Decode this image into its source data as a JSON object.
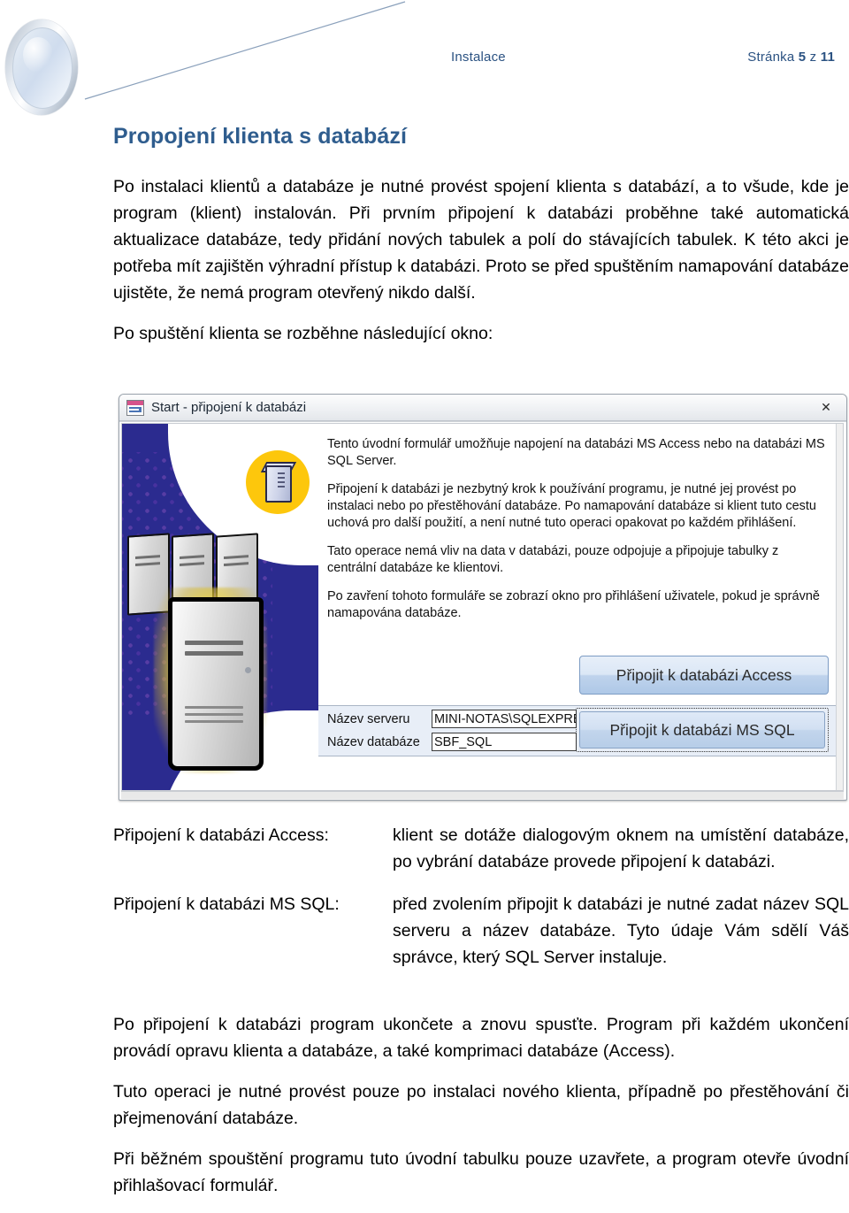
{
  "header": {
    "logo_name": "ellipse-disc-logo",
    "document_title": "Instalace",
    "page_label_prefix": "Stránka ",
    "page_current": "5",
    "page_mid": " z ",
    "page_total": "11",
    "accent_color": "#2b5282"
  },
  "heading": {
    "text": "Propojení klienta s databází",
    "color": "#2f5d8e"
  },
  "intro": {
    "paragraph_1": "Po instalaci klientů a databáze je nutné provést spojení klienta s databází, a to všude, kde je program (klient) instalován. Při prvním připojení k databázi proběhne také automatická aktualizace databáze, tedy přidání nových tabulek a polí do stávajících tabulek. K této akci je potřeba mít zajištěn výhradní přístup k databázi. Proto se před spuštěním namapování databáze ujistěte, že nemá program otevřený nikdo další.",
    "paragraph_2": "Po spuštění klienta se rozběhne následující okno:"
  },
  "screenshot_window": {
    "title": "Start - připojení k databázi",
    "title_icon": "access-form-icon",
    "close_icon": "✕",
    "artwork": {
      "background_color": "#2b2b8f",
      "badge_color": "#fdc70c",
      "badge_icon": "database-server-icon",
      "server_icon": "server-tower-icon"
    },
    "paragraphs": [
      "Tento úvodní formulář umožňuje napojení na databázi MS Access nebo na databázi MS SQL Server.",
      "Připojení k databázi je nezbytný krok k používání programu, je nutné jej provést po instalaci nebo po přestěhování databáze. Po namapování databáze si klient tuto cestu uchová pro další použití, a není nutné tuto operaci opakovat po každém přihlášení.",
      "Tato operace nemá vliv na data v databázi, pouze odpojuje a připojuje tabulky z centrální databáze ke klientovi.",
      "Po zavření tohoto formuláře se zobrazí okno pro přihlášení uživatele, pokud je správně namapována databáze."
    ],
    "button_access": "Připojit k databázi Access",
    "button_mssql": "Připojit k databázi MS SQL",
    "fields": [
      {
        "label": "Název serveru",
        "value": "MINI-NOTAS\\SQLEXPRESS"
      },
      {
        "label": "Název databáze",
        "value": "SBF_SQL"
      }
    ]
  },
  "definitions": [
    {
      "term": "Připojení k databázi Access:",
      "description": "klient se dotáže dialogovým oknem na umístění databáze, po vybrání databáze provede připojení k databázi."
    },
    {
      "term": "Připojení k databázi MS SQL:",
      "description": "před zvolením připojit k databázi je nutné zadat název SQL serveru a název databáze. Tyto údaje Vám sdělí Váš správce, který SQL Server instaluje."
    }
  ],
  "closing": {
    "paragraph_1": "Po připojení k databázi program ukončete a znovu spusťte. Program při každém ukončení provádí opravu klienta a databáze, a také komprimaci databáze (Access).",
    "paragraph_2": "Tuto operaci je nutné provést pouze po instalaci nového klienta, případně po přestěhování či přejmenování databáze.",
    "paragraph_3": "Při běžném spouštění programu tuto úvodní tabulku pouze uzavřete, a program otevře úvodní přihlašovací formulář."
  }
}
